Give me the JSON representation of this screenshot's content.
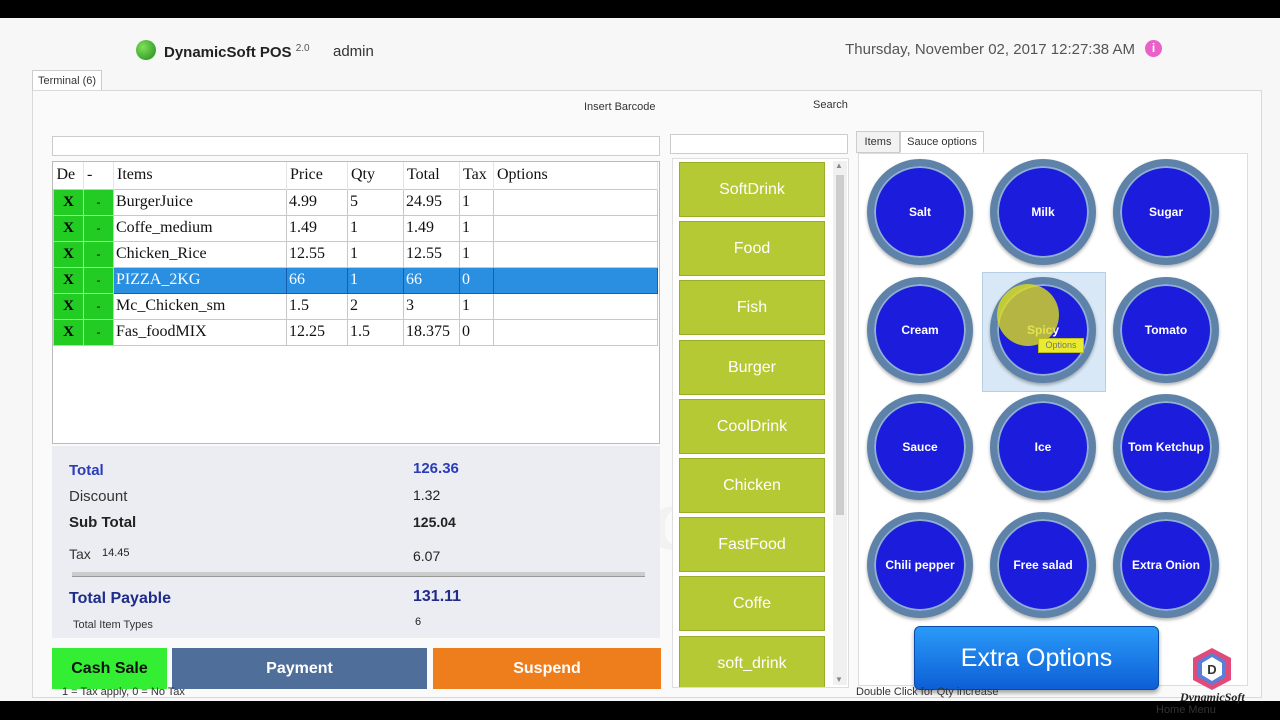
{
  "header": {
    "brand": "DynamicSoft POS",
    "version": "2.0",
    "user": "admin",
    "datetime": "Thursday,  November 02,  2017  12:27:38  AM"
  },
  "terminal_tab": "Terminal (6)",
  "barcode": {
    "label": "Insert Barcode",
    "value": ""
  },
  "search": {
    "label": "Search",
    "value": ""
  },
  "grid": {
    "columns": [
      "De",
      "-",
      "Items",
      "Price",
      "Qty",
      "Total",
      "Tax",
      "Options"
    ],
    "rows": [
      {
        "del": "X",
        "minus": "-",
        "item": "BurgerJuice",
        "price": "4.99",
        "qty": "5",
        "total": "24.95",
        "tax": "1",
        "options": ""
      },
      {
        "del": "X",
        "minus": "-",
        "item": "Coffe_medium",
        "price": "1.49",
        "qty": "1",
        "total": "1.49",
        "tax": "1",
        "options": ""
      },
      {
        "del": "X",
        "minus": "-",
        "item": "Chicken_Rice",
        "price": "12.55",
        "qty": "1",
        "total": "12.55",
        "tax": "1",
        "options": ""
      },
      {
        "del": "X",
        "minus": "-",
        "item": "PIZZA_2KG",
        "price": "66",
        "qty": "1",
        "total": "66",
        "tax": "0",
        "options": ""
      },
      {
        "del": "X",
        "minus": "-",
        "item": "Mc_Chicken_sm",
        "price": "1.5",
        "qty": "2",
        "total": "3",
        "tax": "1",
        "options": ""
      },
      {
        "del": "X",
        "minus": "-",
        "item": "Fas_foodMIX",
        "price": "12.25",
        "qty": "1.5",
        "total": "18.375",
        "tax": "0",
        "options": ""
      }
    ]
  },
  "totals": {
    "total_label": "Total",
    "total_value": "126.36",
    "discount_label": "Discount",
    "discount_value": "1.32",
    "subtotal_label": "Sub Total",
    "subtotal_value": "125.04",
    "tax_label": "Tax",
    "tax_rate": "14.45",
    "tax_value": "6.07",
    "payable_label": "Total Payable",
    "payable_value": "131.11",
    "item_types_label": "Total Item Types",
    "item_types_value": "6"
  },
  "buttons": {
    "cash_sale": "Cash Sale",
    "payment": "Payment",
    "suspend": "Suspend",
    "extra_options": "Extra Options"
  },
  "tax_note": "1 = Tax apply, 0 = No Tax",
  "categories": [
    "SoftDrink",
    "Food",
    "Fish",
    "Burger",
    "CoolDrink",
    "Chicken",
    "FastFood",
    "Coffe",
    "soft_drink"
  ],
  "right_tabs": {
    "items": "Items",
    "sauce": "Sauce options"
  },
  "sauces": [
    "Salt",
    "Milk",
    "Sugar",
    "Cream",
    "Spicy",
    "Tomato",
    "Sauce",
    "Ice",
    "Tom Ketchup",
    "Chili pepper",
    "Free salad",
    "Extra Onion"
  ],
  "tooltip": "Options",
  "qty_hint": "Double Click for Qty increase",
  "footer_brand": "DynamicSoft",
  "home_menu": "Home Menu",
  "colors": {
    "category_bg": "#b4c934",
    "sauce_bg": "#1c1cdc",
    "cash_sale": "#33ee33",
    "payment": "#4f6f9a",
    "suspend": "#ee7d1c",
    "selected_row": "#2a8fe0"
  }
}
